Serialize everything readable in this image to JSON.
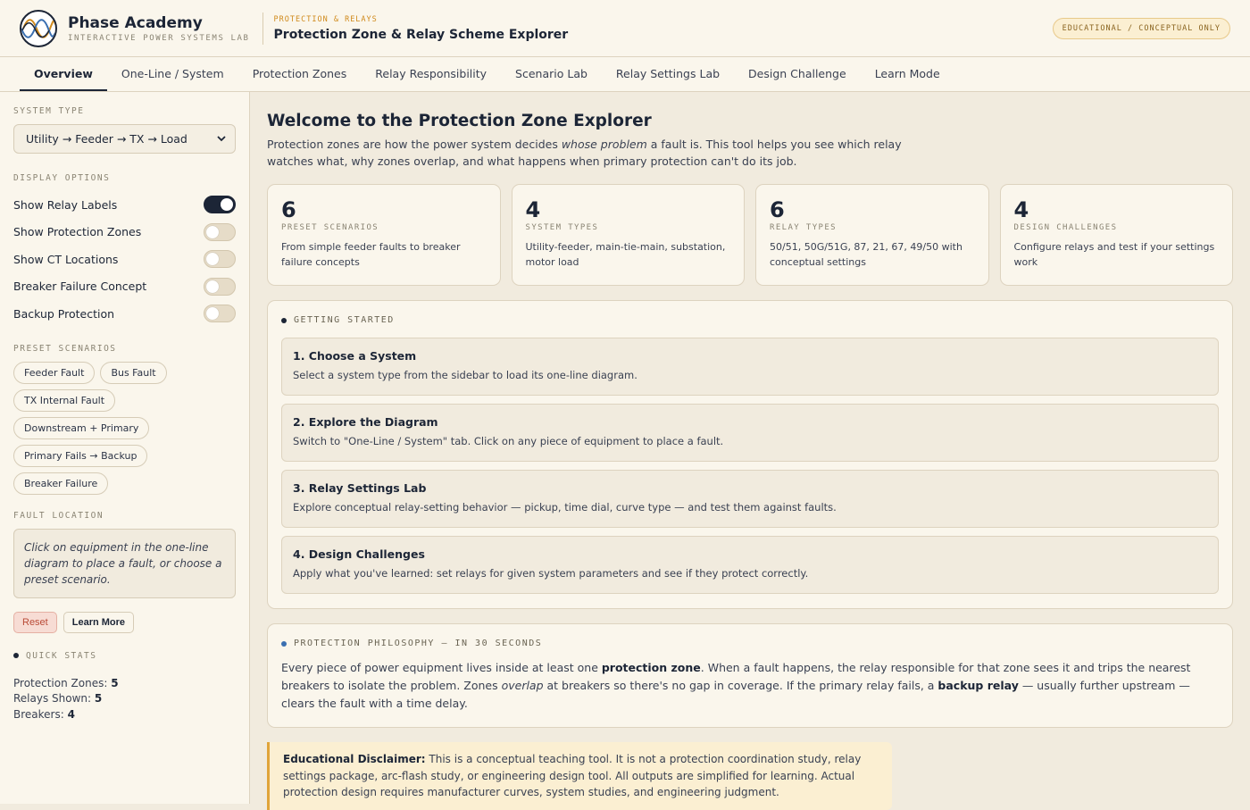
{
  "header": {
    "brand_name": "Phase Academy",
    "brand_sub": "INTERACTIVE POWER SYSTEMS LAB",
    "section_tag": "PROTECTION & RELAYS",
    "section_title": "Protection Zone & Relay Scheme Explorer",
    "badge": "EDUCATIONAL / CONCEPTUAL ONLY"
  },
  "tabs": [
    {
      "label": "Overview",
      "active": true
    },
    {
      "label": "One-Line / System"
    },
    {
      "label": "Protection Zones"
    },
    {
      "label": "Relay Responsibility"
    },
    {
      "label": "Scenario Lab"
    },
    {
      "label": "Relay Settings Lab"
    },
    {
      "label": "Design Challenge"
    },
    {
      "label": "Learn Mode"
    }
  ],
  "sidebar": {
    "system_type_label": "SYSTEM TYPE",
    "system_type_value": "Utility → Feeder → TX → Load",
    "display_options_label": "DISPLAY OPTIONS",
    "toggles": [
      {
        "label": "Show Relay Labels",
        "on": true
      },
      {
        "label": "Show Protection Zones",
        "on": false
      },
      {
        "label": "Show CT Locations",
        "on": false
      },
      {
        "label": "Breaker Failure Concept",
        "on": false
      },
      {
        "label": "Backup Protection",
        "on": false
      }
    ],
    "preset_label": "PRESET SCENARIOS",
    "presets": [
      "Feeder Fault",
      "Bus Fault",
      "TX Internal Fault",
      "Downstream + Primary",
      "Primary Fails → Backup",
      "Breaker Failure"
    ],
    "fault_label": "FAULT LOCATION",
    "fault_hint": "Click on equipment in the one-line diagram to place a fault, or choose a preset scenario.",
    "reset_label": "Reset",
    "learn_more_label": "Learn More",
    "quick_stats_label": "QUICK STATS",
    "stats": [
      {
        "label": "Protection Zones:",
        "value": "5"
      },
      {
        "label": "Relays Shown:",
        "value": "5"
      },
      {
        "label": "Breakers:",
        "value": "4"
      }
    ]
  },
  "main": {
    "title": "Welcome to the Protection Zone Explorer",
    "intro_1": "Protection zones are how the power system decides ",
    "intro_em": "whose problem",
    "intro_2": " a fault is. This tool helps you see which relay watches what, why zones overlap, and what happens when primary protection can't do its job.",
    "cards": [
      {
        "num": "6",
        "label": "PRESET SCENARIOS",
        "desc": "From simple feeder faults to breaker failure concepts"
      },
      {
        "num": "4",
        "label": "SYSTEM TYPES",
        "desc": "Utility-feeder, main-tie-main, substation, motor load"
      },
      {
        "num": "6",
        "label": "RELAY TYPES",
        "desc": "50/51, 50G/51G, 87, 21, 67, 49/50 with conceptual settings"
      },
      {
        "num": "4",
        "label": "DESIGN CHALLENGES",
        "desc": "Configure relays and test if your settings work"
      }
    ],
    "getting_started_label": "GETTING STARTED",
    "steps": [
      {
        "title": "1. Choose a System",
        "desc": "Select a system type from the sidebar to load its one-line diagram."
      },
      {
        "title": "2. Explore the Diagram",
        "desc": "Switch to \"One-Line / System\" tab. Click on any piece of equipment to place a fault."
      },
      {
        "title": "3. Relay Settings Lab",
        "desc": "Explore conceptual relay-setting behavior — pickup, time dial, curve type — and test them against faults."
      },
      {
        "title": "4. Design Challenges",
        "desc": "Apply what you've learned: set relays for given system parameters and see if they protect correctly."
      }
    ],
    "philosophy_label": "PROTECTION PHILOSOPHY — IN 30 SECONDS",
    "phil": {
      "p1": "Every piece of power equipment lives inside at least one ",
      "b1": "protection zone",
      "p2": ". When a fault happens, the relay responsible for that zone sees it and trips the nearest breakers to isolate the problem. Zones ",
      "em1": "overlap",
      "p3": " at breakers so there's no gap in coverage. If the primary relay fails, a ",
      "b2": "backup relay",
      "p4": " — usually further upstream — clears the fault with a time delay."
    },
    "disclaimer_title": "Educational Disclaimer:",
    "disclaimer_text": " This is a conceptual teaching tool. It is not a protection coordination study, relay settings package, arc-flash study, or engineering design tool. All outputs are simplified for learning. Actual protection design requires manufacturer curves, system studies, and engineering judgment."
  },
  "colors": {
    "accent_navy": "#1c2536",
    "accent_amber": "#d08a1c",
    "background": "#f1ebde",
    "panel": "#faf6ec"
  }
}
